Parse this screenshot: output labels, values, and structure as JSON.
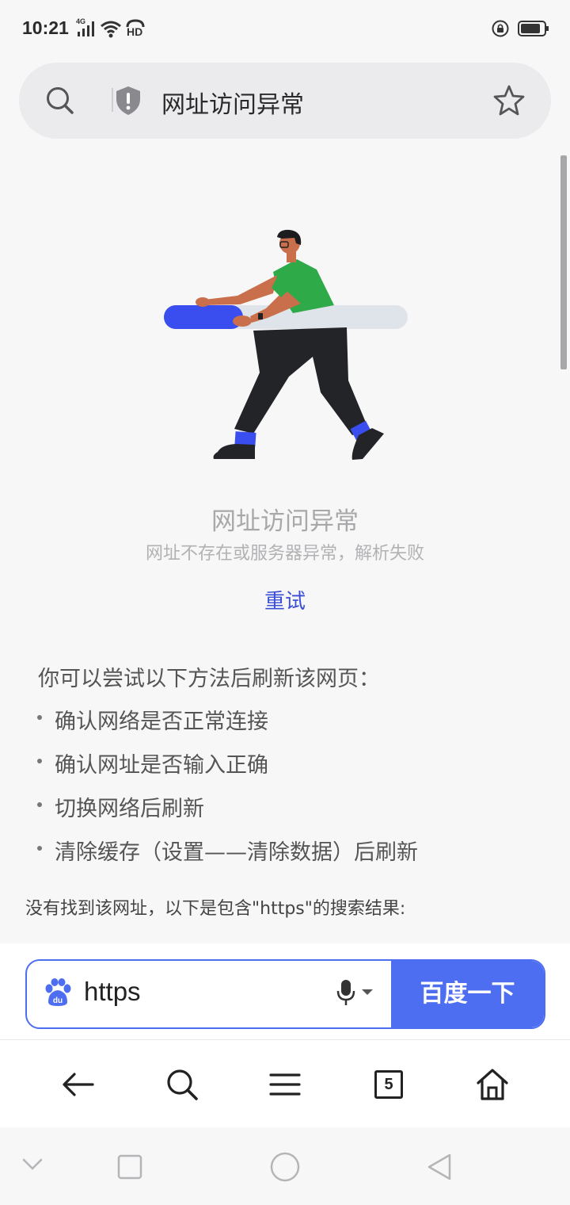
{
  "status_bar": {
    "time": "10:21",
    "network": "4G",
    "hd": "HD",
    "icons": [
      "signal-icon",
      "wifi-icon",
      "hd-call-icon",
      "rotation-lock-icon",
      "battery-icon"
    ]
  },
  "address_bar": {
    "title": "网址访问异常",
    "icons": [
      "search-icon",
      "shield-warning-icon",
      "star-icon"
    ]
  },
  "error": {
    "title": "网址访问异常",
    "subtitle": "网址不存在或服务器异常，解析失败",
    "retry_label": "重试"
  },
  "tips": {
    "heading": "你可以尝试以下方法后刷新该网页：",
    "items": [
      "确认网络是否正常连接",
      "确认网址是否输入正确",
      "切换网络后刷新",
      "清除缓存（设置——清除数据）后刷新"
    ]
  },
  "search_note": "没有找到该网址，以下是包含\"https\"的搜索结果:",
  "search": {
    "query": "https",
    "button_label": "百度一下",
    "accent_color": "#4e6ef2"
  },
  "bottom_nav": {
    "tab_count": "5",
    "items": [
      "back-arrow-icon",
      "search-icon",
      "menu-icon",
      "tabs-icon",
      "home-icon"
    ]
  },
  "system_nav": {
    "items": [
      "chevron-down-icon",
      "recents-square-icon",
      "home-circle-icon",
      "back-triangle-icon"
    ]
  }
}
